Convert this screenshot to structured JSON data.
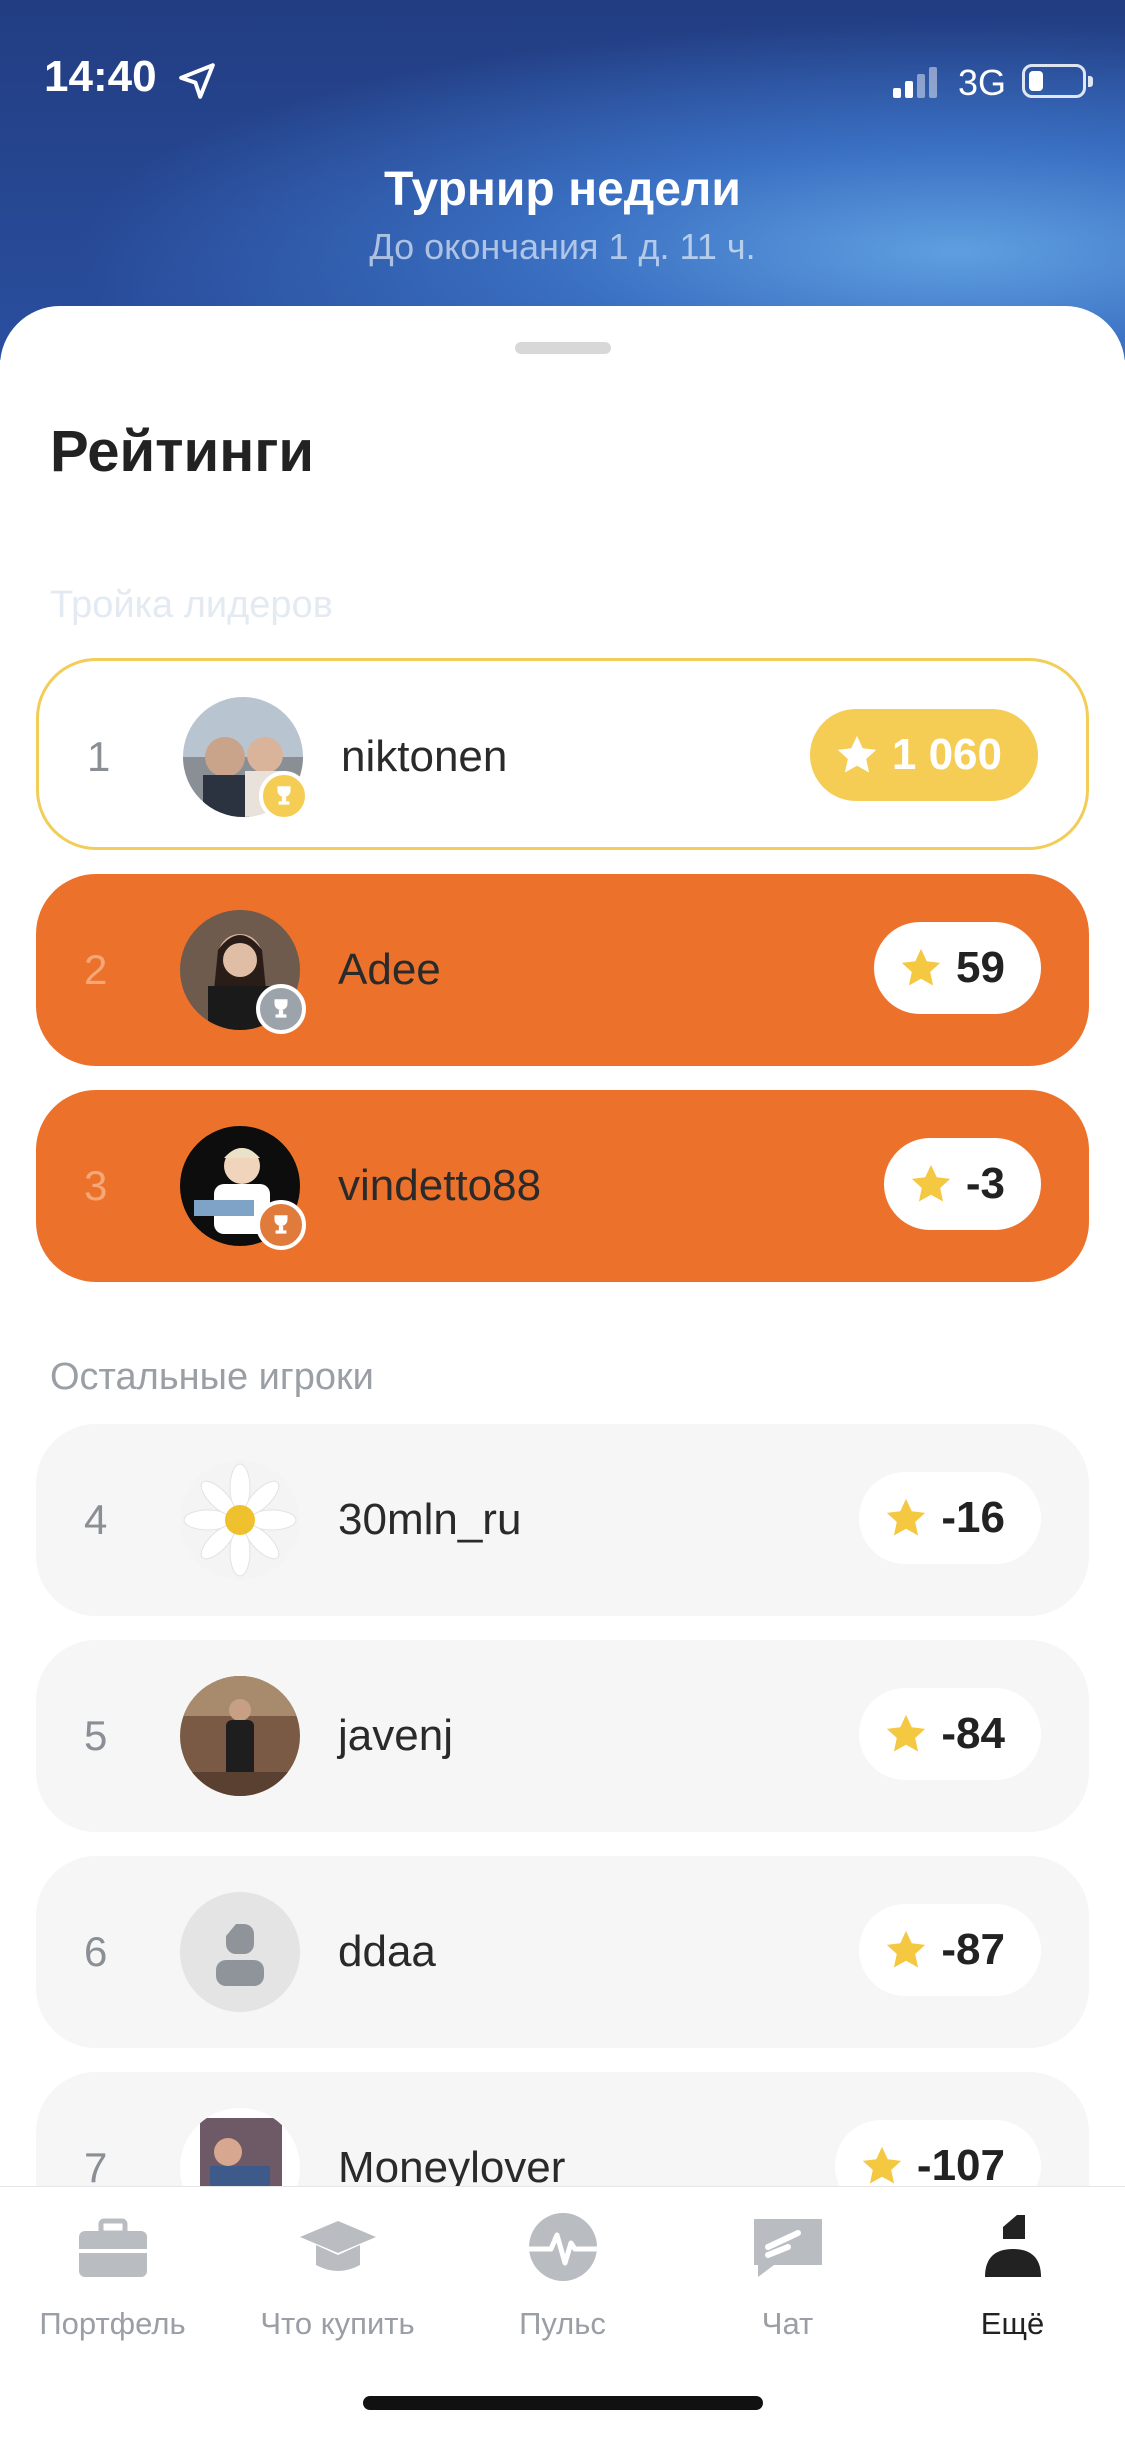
{
  "status": {
    "time": "14:40",
    "network": "3G"
  },
  "header": {
    "title": "Турнир недели",
    "subtitle": "До окончания 1 д. 11 ч."
  },
  "sheet": {
    "title": "Рейтинги",
    "leaders_label": "Тройка лидеров",
    "others_label": "Остальные игроки"
  },
  "leaders": [
    {
      "rank": "1",
      "name": "niktonen",
      "score": "1 060"
    },
    {
      "rank": "2",
      "name": "Adee",
      "score": "59"
    },
    {
      "rank": "3",
      "name": "vindetto88",
      "score": "-3"
    }
  ],
  "others": [
    {
      "rank": "4",
      "name": "30mln_ru",
      "score": "-16"
    },
    {
      "rank": "5",
      "name": "javenj",
      "score": "-84"
    },
    {
      "rank": "6",
      "name": "ddaa",
      "score": "-87"
    },
    {
      "rank": "7",
      "name": "Moneylover",
      "score": "-107"
    }
  ],
  "tabs": [
    "Портфель",
    "Что купить",
    "Пульс",
    "Чат",
    "Ещё"
  ],
  "colors": {
    "accent_orange": "#ec722c",
    "gold": "#f5cd55",
    "header_blue": "#2a4f9f"
  }
}
